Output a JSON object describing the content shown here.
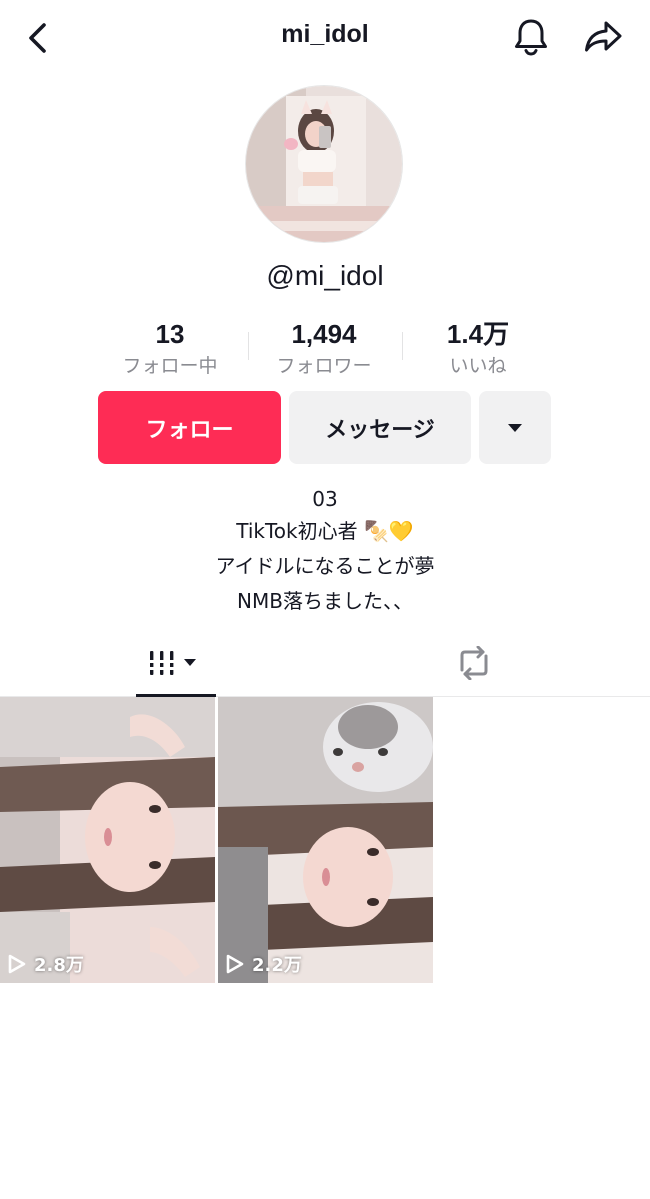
{
  "header": {
    "title": "mi_idol",
    "icons": [
      "chevron-left-icon",
      "bell-icon",
      "share-icon"
    ]
  },
  "profile": {
    "handle": "@mi_idol",
    "stats": [
      {
        "value": "13",
        "label": "フォロー中"
      },
      {
        "value": "1,494",
        "label": "フォロワー"
      },
      {
        "value": "1.4万",
        "label": "いいね"
      }
    ]
  },
  "actions": {
    "follow_label": "フォロー",
    "message_label": "メッセージ",
    "more_icon": "caret-down-icon"
  },
  "bio": {
    "lines": [
      "03",
      "TikTok初心者 🍢💛",
      "アイドルになることが夢",
      "NMB落ちました、、"
    ]
  },
  "tabs": {
    "videos_icon": "videos-grid-icon",
    "reposts_icon": "repost-icon"
  },
  "videos": [
    {
      "views": "2.8万"
    },
    {
      "views": "2.2万"
    }
  ],
  "colors": {
    "accent": "#fe2c55",
    "secondary_button": "#f1f1f2",
    "muted_text": "#8a8b91"
  }
}
